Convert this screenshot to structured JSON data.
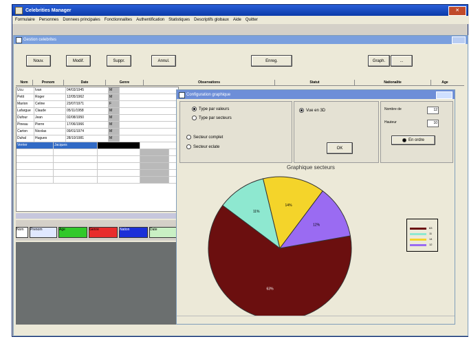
{
  "app": {
    "title": "Celebrities Manager",
    "menu": [
      "Formulaire",
      "Personnes",
      "Donnees principales",
      "Fonctionnalites",
      "Authentification",
      "Statistiques",
      "Descriptifs globaux",
      "Aide",
      "Quitter"
    ]
  },
  "child": {
    "title": "Gestion celebrites",
    "buttons": [
      "Nouv.",
      "Modif.",
      "Suppr.",
      "Annul.",
      "Enreg.",
      "Graph.",
      "..."
    ]
  },
  "grid": {
    "columns": [
      "Nom",
      "Prenom",
      "Date",
      "Genre",
      "Observations",
      "Statut",
      "Nationalite",
      "Age"
    ],
    "rows": [
      [
        "Ucu",
        "Ivan",
        "04/03/1945",
        "M"
      ],
      [
        "Petit",
        "Roger",
        "12/05/1962",
        "M"
      ],
      [
        "Marion",
        "Celine",
        "23/07/1971",
        "F"
      ],
      [
        "Lafargue",
        "Claude",
        "05/11/1958",
        "M"
      ],
      [
        "Dufour",
        "Jean",
        "02/08/1950",
        "M"
      ],
      [
        "Pineau",
        "Pierre",
        "17/06/1966",
        "M"
      ],
      [
        "Carton",
        "Nicolas",
        "09/01/1974",
        "M"
      ],
      [
        "Duhal",
        "Hugues",
        "28/10/1981",
        "M"
      ]
    ],
    "selected_row": [
      "Verrier",
      "Jacques",
      "",
      ""
    ]
  },
  "legend_strip": {
    "labels": [
      "Nom",
      "Prenom",
      "Age",
      "Genre",
      "Nation",
      "Date"
    ]
  },
  "dialog": {
    "title": "Configuration graphique",
    "options_left": [
      "Type par valeurs",
      "Type par secteurs"
    ],
    "options_left2": [
      "Secteur complet",
      "Secteur eclate"
    ],
    "option_mid": "Vue en 3D",
    "ok_label": "OK",
    "spin1_label": "Nombre de",
    "spin1_value": "12",
    "spin2_label": "Hauteur",
    "spin2_value": "10",
    "radio_right": "En ordre"
  },
  "chart_data": {
    "type": "pie",
    "title": "Graphique secteurs",
    "categories": [
      "A",
      "B",
      "C",
      "D"
    ],
    "values": [
      63,
      11,
      14,
      12
    ],
    "colors": [
      "#6b0f0f",
      "#8ee8d0",
      "#f4d42a",
      "#9a6bf2"
    ],
    "slice_labels": [
      "63%",
      "11%",
      "14%",
      "12%"
    ],
    "legend_values": [
      "63",
      "11",
      "14",
      "12"
    ]
  }
}
